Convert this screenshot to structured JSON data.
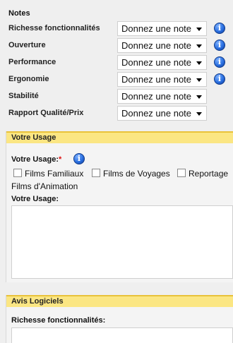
{
  "notes": {
    "title": "Notes",
    "select_value": "Donnez une note",
    "rows": [
      {
        "label": "Richesse fonctionnalités",
        "info": true
      },
      {
        "label": "Ouverture",
        "info": true
      },
      {
        "label": "Performance",
        "info": true
      },
      {
        "label": "Ergonomie",
        "info": true
      },
      {
        "label": "Stabilité",
        "info": false
      },
      {
        "label": "Rapport Qualité/Prix",
        "info": false
      }
    ]
  },
  "usage": {
    "header": "Votre Usage",
    "field_label": "Votre Usage:",
    "required_mark": "*",
    "checkboxes": [
      "Films Familiaux",
      "Films de Voyages",
      "Reportage",
      "Films d'Animation"
    ],
    "textarea_label": "Votre Usage:"
  },
  "avis": {
    "header": "Avis Logiciels",
    "field_label": "Richesse fonctionnalités:"
  },
  "icons": {
    "info": "info-icon",
    "caret": "chevron-down-icon"
  },
  "colors": {
    "section_header_bg": "#fbe683",
    "section_header_border": "#e9c23a",
    "required": "#dd1111",
    "info_icon": "#2a6fe0"
  }
}
